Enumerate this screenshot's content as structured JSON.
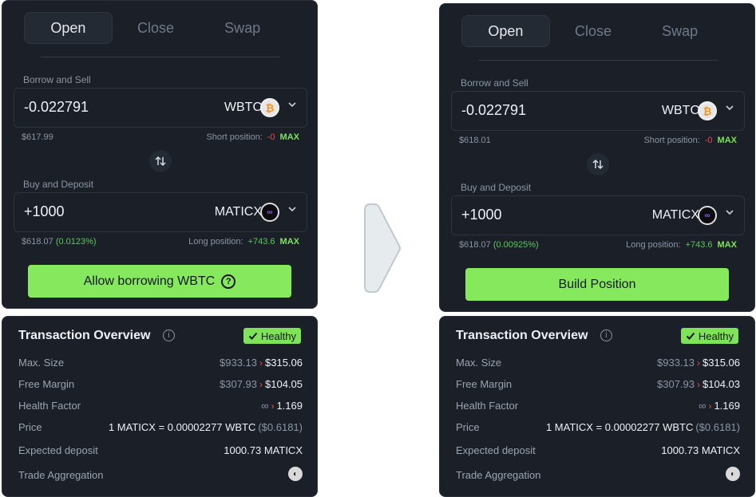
{
  "left": {
    "tabs": [
      "Open",
      "Close",
      "Swap"
    ],
    "borrow_label": "Borrow and Sell",
    "borrow_amount": "-0.022791",
    "borrow_token": "WBTC",
    "borrow_usd": "$617.99",
    "short_label": "Short position:",
    "short_value": "-0",
    "max": "MAX",
    "buy_label": "Buy and Deposit",
    "buy_amount": "+1000",
    "buy_token": "MATICX",
    "buy_usd": "$618.07",
    "buy_pct": "(0.0123%)",
    "long_label": "Long position:",
    "long_value": "+743.6",
    "action": "Allow borrowing WBTC",
    "overview": {
      "title": "Transaction Overview",
      "healthy": "Healthy",
      "max_size_label": "Max. Size",
      "max_size_old": "$933.13",
      "max_size_new": "$315.06",
      "free_margin_label": "Free Margin",
      "free_margin_old": "$307.93",
      "free_margin_new": "$104.05",
      "health_label": "Health Factor",
      "health_old": "∞",
      "health_new": "1.169",
      "price_label": "Price",
      "price_value": "1 MATICX = 0.00002277 WBTC",
      "price_usd": "($0.6181)",
      "deposit_label": "Expected deposit",
      "deposit_value": "1000.73 MATICX",
      "agg_label": "Trade Aggregation"
    }
  },
  "right": {
    "tabs": [
      "Open",
      "Close",
      "Swap"
    ],
    "borrow_label": "Borrow and Sell",
    "borrow_amount": "-0.022791",
    "borrow_token": "WBTC",
    "borrow_usd": "$618.01",
    "short_label": "Short position:",
    "short_value": "-0",
    "max": "MAX",
    "buy_label": "Buy and Deposit",
    "buy_amount": "+1000",
    "buy_token": "MATICX",
    "buy_usd": "$618.07",
    "buy_pct": "(0.00925%)",
    "long_label": "Long position:",
    "long_value": "+743.6",
    "action": "Build Position",
    "overview": {
      "title": "Transaction Overview",
      "healthy": "Healthy",
      "max_size_label": "Max. Size",
      "max_size_old": "$933.13",
      "max_size_new": "$315.06",
      "free_margin_label": "Free Margin",
      "free_margin_old": "$307.93",
      "free_margin_new": "$104.03",
      "health_label": "Health Factor",
      "health_old": "∞",
      "health_new": "1.169",
      "price_label": "Price",
      "price_value": "1 MATICX = 0.00002277 WBTC",
      "price_usd": "($0.6181)",
      "deposit_label": "Expected deposit",
      "deposit_value": "1000.73 MATICX",
      "agg_label": "Trade Aggregation"
    }
  },
  "colors": {
    "accent": "#85e85d",
    "panel": "#1b2028",
    "negative": "#e24b4b",
    "positive": "#5ac85a"
  }
}
